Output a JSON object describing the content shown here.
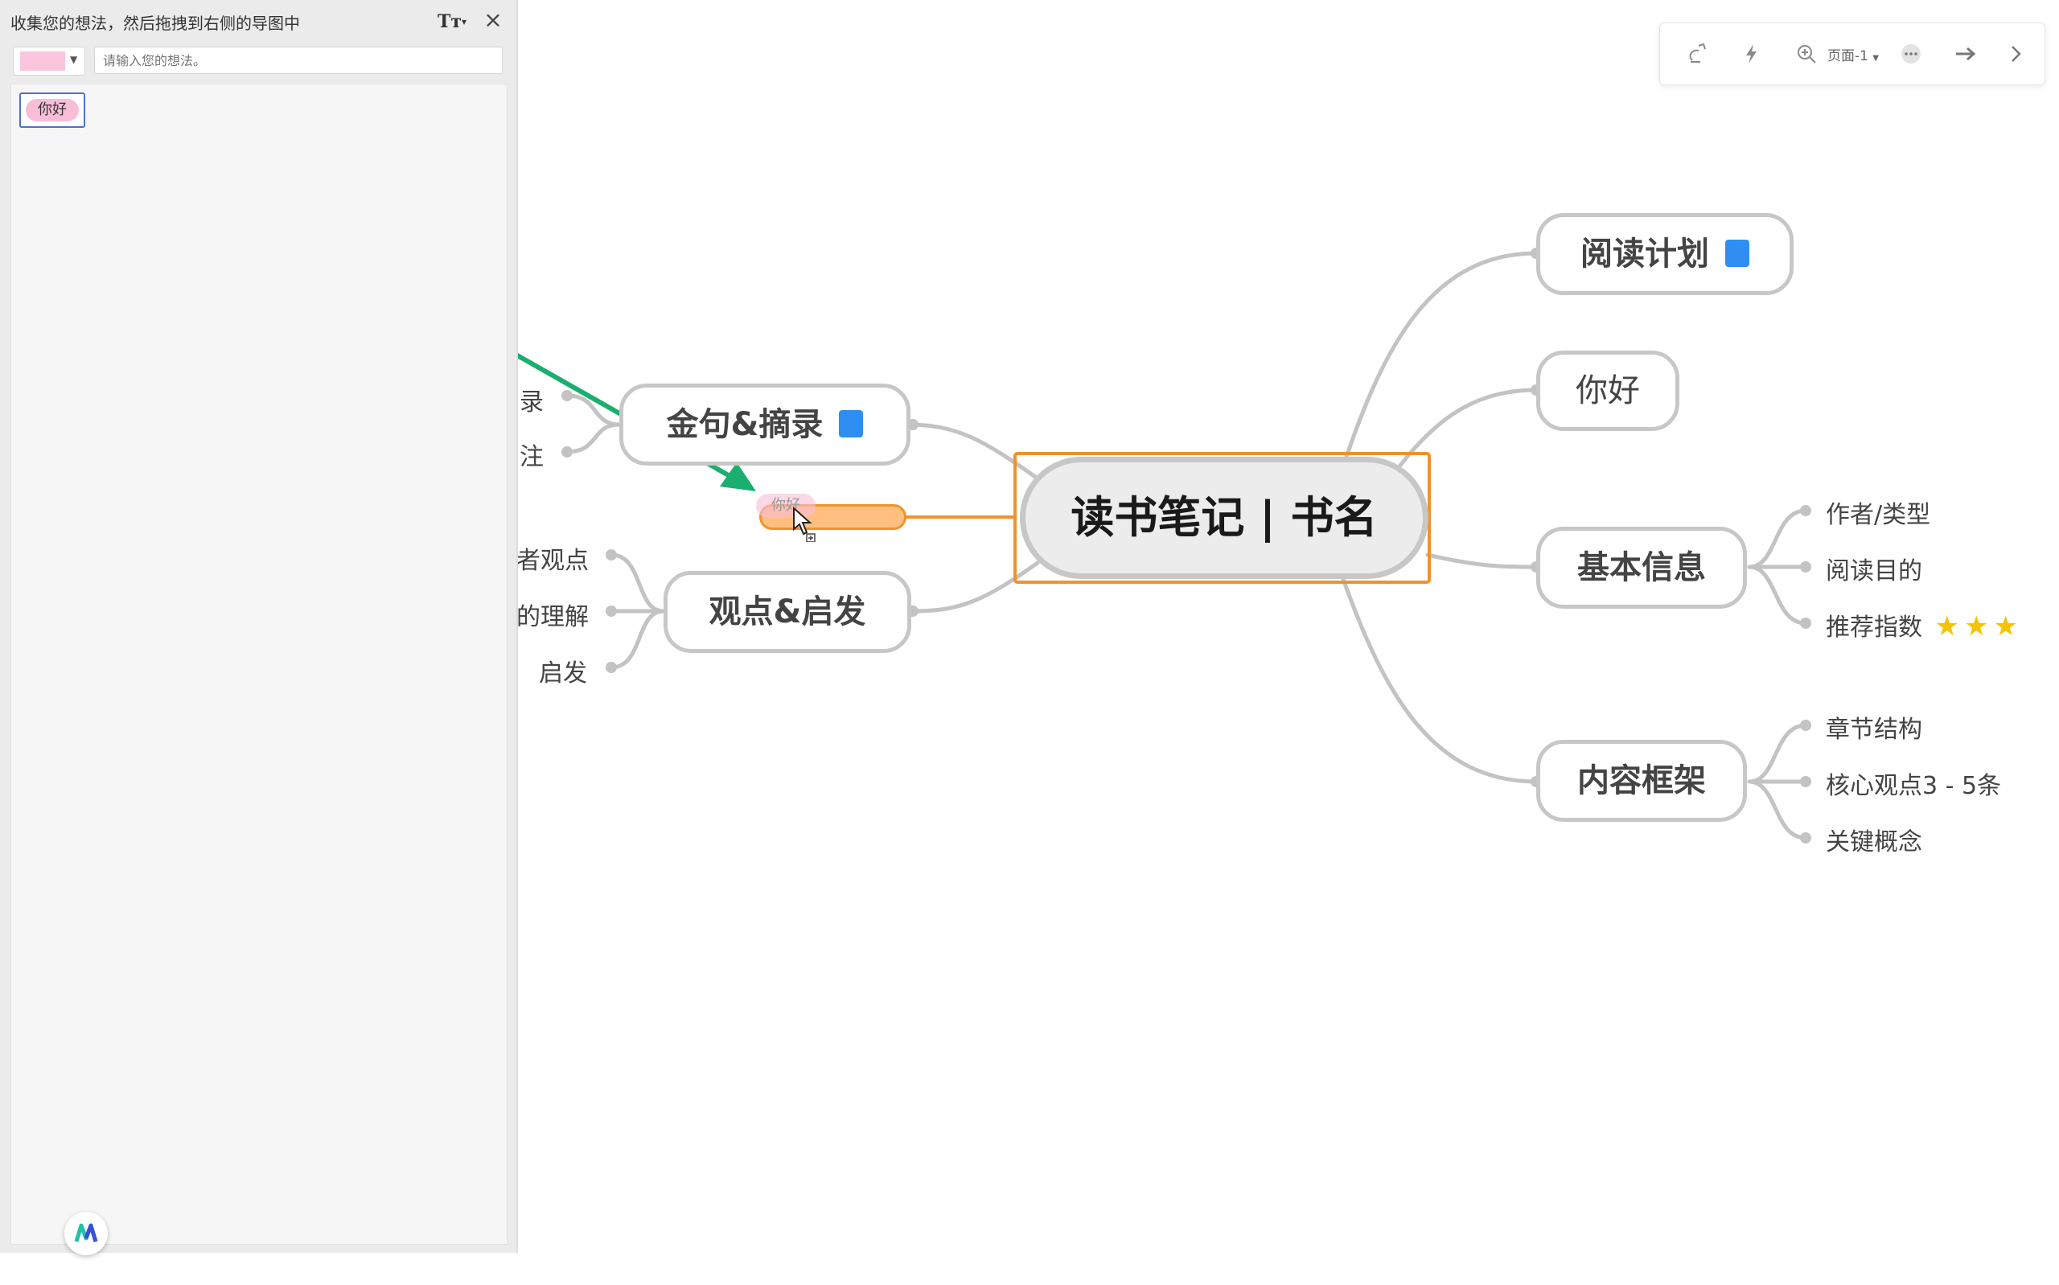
{
  "idea_panel": {
    "title": "收集您的想法，然后拖拽到右侧的导图中",
    "font_button": "Tт",
    "color_swatch": "#fbc5dd",
    "input_placeholder": "请输入您的想法。",
    "ideas": [
      "你好"
    ]
  },
  "toolbar": {
    "zoom": "页面-1",
    "icons": [
      "undo-icon",
      "lightning-icon",
      "zoom-in-icon",
      "more-icon",
      "arrow-right-icon",
      "chevron-right-icon"
    ]
  },
  "mindmap": {
    "central": "读书笔记 | 书名",
    "right_topics": [
      {
        "label": "阅读计划",
        "has_note": true,
        "children": []
      },
      {
        "label": "你好",
        "has_note": false,
        "children": []
      },
      {
        "label": "基本信息",
        "has_note": false,
        "children": [
          "作者/类型",
          "阅读目的",
          "推荐指数"
        ]
      },
      {
        "label": "内容框架",
        "has_note": false,
        "children": [
          "章节结构",
          "核心观点3 - 5条",
          "关键概念"
        ]
      }
    ],
    "left_topics": [
      {
        "label": "金句&摘录",
        "has_note": true,
        "children": [
          "录",
          "注"
        ]
      },
      {
        "label": "观点&启发",
        "has_note": false,
        "children": [
          "者观点",
          "的理解",
          "启发"
        ]
      }
    ],
    "rating_stars": 3,
    "drag_ghost_text": "你好"
  },
  "colors": {
    "connector": "#c3c3c3",
    "selection": "#f0922b",
    "drag_arrow": "#1aae6f",
    "note_icon": "#2e8ef3",
    "star": "#f5c400"
  }
}
